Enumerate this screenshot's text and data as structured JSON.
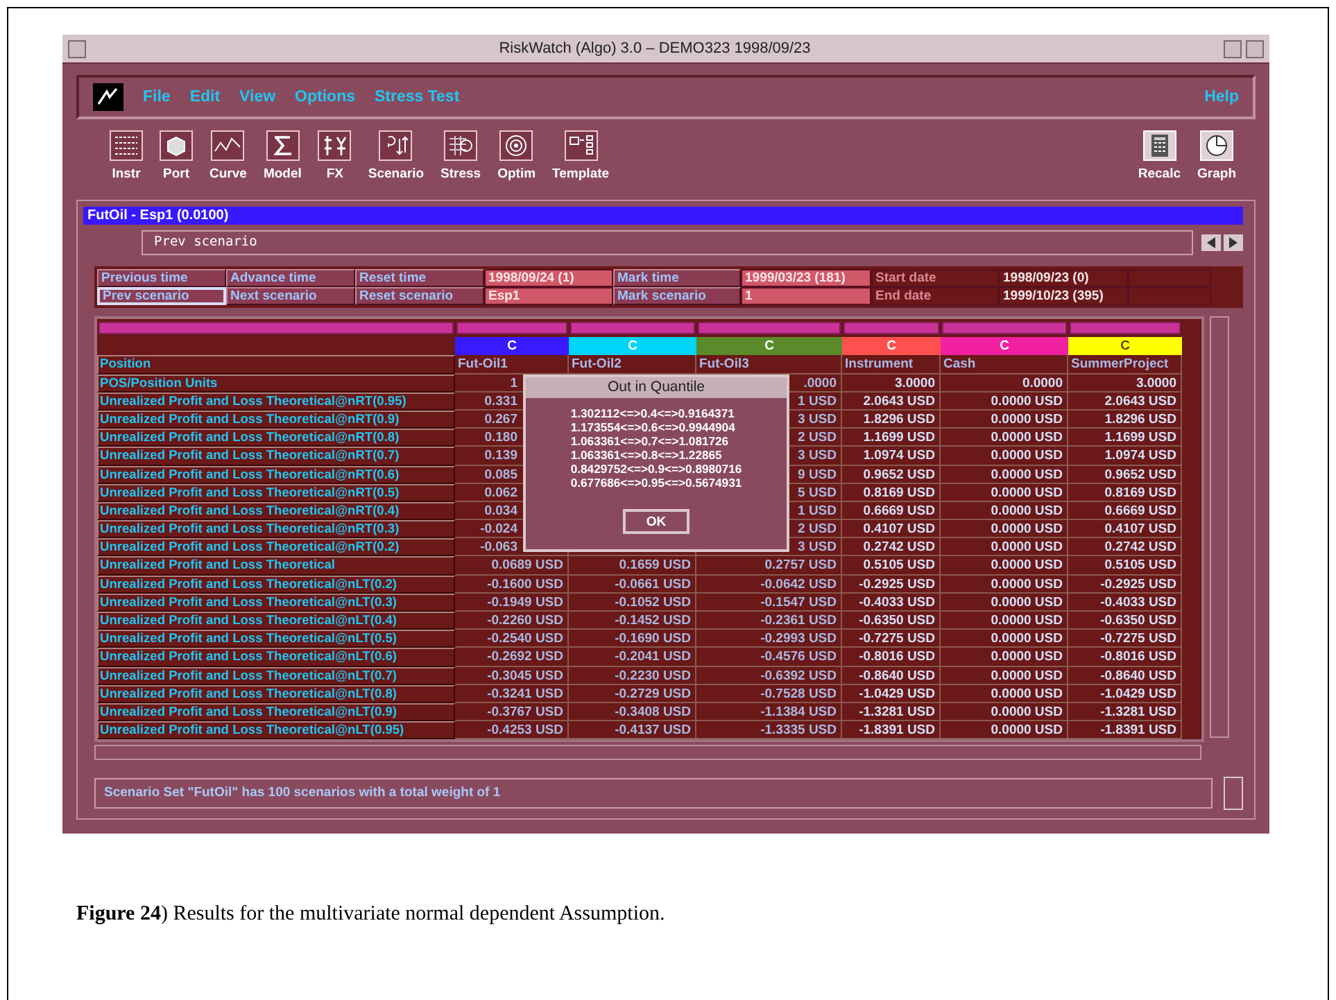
{
  "window": {
    "title": "RiskWatch (Algo) 3.0 – DEMO323 1998/09/23"
  },
  "menu": [
    {
      "label": "File"
    },
    {
      "label": "Edit"
    },
    {
      "label": "View"
    },
    {
      "label": "Options"
    },
    {
      "label": "Stress Test"
    }
  ],
  "help_menu": {
    "label": "Help"
  },
  "toolbar": [
    {
      "label": "Instr",
      "kind": "instr"
    },
    {
      "label": "Port",
      "kind": "port"
    },
    {
      "label": "Curve",
      "kind": "curve"
    },
    {
      "label": "Model",
      "kind": "model"
    },
    {
      "label": "FX",
      "kind": "fx"
    },
    {
      "label": "Scenario",
      "kind": "scenario"
    },
    {
      "label": "Stress",
      "kind": "stress"
    },
    {
      "label": "Optim",
      "kind": "optim"
    },
    {
      "label": "Template",
      "kind": "template"
    }
  ],
  "toolbar_right": [
    {
      "label": "Recalc",
      "kind": "recalc"
    },
    {
      "label": "Graph",
      "kind": "graph"
    }
  ],
  "context_bar": "FutOil - Esp1 (0.0100)",
  "message": "Prev scenario",
  "control_grid": [
    [
      {
        "text": "Previous time",
        "kind": "button",
        "selected": false
      },
      {
        "text": "Advance time",
        "kind": "button",
        "selected": false
      },
      {
        "text": "Reset time",
        "kind": "button",
        "selected": false
      },
      {
        "text": "1998/09/24 (1)",
        "kind": "value"
      },
      {
        "text": "Mark time",
        "kind": "button",
        "selected": false
      },
      {
        "text": "1999/03/23 (181)",
        "kind": "value"
      },
      {
        "text": "Start date",
        "kind": "label"
      },
      {
        "text": "1998/09/23 (0)",
        "kind": "info"
      },
      {
        "kind": "blank"
      }
    ],
    [
      {
        "text": "Prev scenario",
        "kind": "button",
        "selected": true
      },
      {
        "text": "Next scenario",
        "kind": "button",
        "selected": false
      },
      {
        "text": "Reset scenario",
        "kind": "button",
        "selected": false
      },
      {
        "text": "Esp1",
        "kind": "value"
      },
      {
        "text": "Mark scenario",
        "kind": "button",
        "selected": false
      },
      {
        "text": "1",
        "kind": "value"
      },
      {
        "text": "End date",
        "kind": "label"
      },
      {
        "text": "1999/10/23 (395)",
        "kind": "info"
      },
      {
        "kind": "blank"
      }
    ]
  ],
  "table": {
    "label_header": "Position",
    "columns": [
      {
        "letter": "C",
        "color": "#3a1aff",
        "name": "Fut-Oil1"
      },
      {
        "letter": "C",
        "color": "#00d4f8",
        "name": "Fut-Oil2"
      },
      {
        "letter": "C",
        "color": "#5a8a2a",
        "name": "Fut-Oil3"
      },
      {
        "letter": "C",
        "color": "#ff5050",
        "name": "Instrument"
      },
      {
        "letter": "C",
        "color": "#f020a0",
        "name": "Cash"
      },
      {
        "letter": "C",
        "color": "#ffff00",
        "name": "SummerProject"
      }
    ],
    "rows": [
      {
        "label": "POS/Position Units",
        "covered": true,
        "cells": [
          "1",
          null,
          ".0000",
          "3.0000",
          "0.0000",
          "3.0000"
        ]
      },
      {
        "label": "Unrealized Profit and Loss Theoretical@nRT(0.95)",
        "covered": true,
        "cells": [
          "0.331",
          null,
          "1 USD",
          "2.0643 USD",
          "0.0000 USD",
          "2.0643 USD"
        ]
      },
      {
        "label": "Unrealized Profit and Loss Theoretical@nRT(0.9)",
        "covered": true,
        "cells": [
          "0.267",
          null,
          "3 USD",
          "1.8296 USD",
          "0.0000 USD",
          "1.8296 USD"
        ]
      },
      {
        "label": "Unrealized Profit and Loss Theoretical@nRT(0.8)",
        "covered": true,
        "cells": [
          "0.180",
          null,
          "2 USD",
          "1.1699 USD",
          "0.0000 USD",
          "1.1699 USD"
        ]
      },
      {
        "label": "Unrealized Profit and Loss Theoretical@nRT(0.7)",
        "covered": true,
        "cells": [
          "0.139",
          null,
          "3 USD",
          "1.0974 USD",
          "0.0000 USD",
          "1.0974 USD"
        ]
      },
      {
        "label": "Unrealized Profit and Loss Theoretical@nRT(0.6)",
        "covered": true,
        "cells": [
          "0.085",
          null,
          "9 USD",
          "0.9652 USD",
          "0.0000 USD",
          "0.9652 USD"
        ]
      },
      {
        "label": "Unrealized Profit and Loss Theoretical@nRT(0.5)",
        "covered": true,
        "cells": [
          "0.062",
          null,
          "5 USD",
          "0.8169 USD",
          "0.0000 USD",
          "0.8169 USD"
        ]
      },
      {
        "label": "Unrealized Profit and Loss Theoretical@nRT(0.4)",
        "covered": true,
        "cells": [
          "0.034",
          null,
          "1 USD",
          "0.6669 USD",
          "0.0000 USD",
          "0.6669 USD"
        ]
      },
      {
        "label": "Unrealized Profit and Loss Theoretical@nRT(0.3)",
        "covered": true,
        "cells": [
          "-0.024",
          null,
          "2 USD",
          "0.4107 USD",
          "0.0000 USD",
          "0.4107 USD"
        ]
      },
      {
        "label": "Unrealized Profit and Loss Theoretical@nRT(0.2)",
        "covered": true,
        "cells": [
          "-0.063",
          null,
          "3 USD",
          "0.2742 USD",
          "0.0000 USD",
          "0.2742 USD"
        ]
      },
      {
        "label": "Unrealized Profit and Loss Theoretical",
        "covered": false,
        "cells": [
          "0.0689 USD",
          "0.1659 USD",
          "0.2757 USD",
          "0.5105 USD",
          "0.0000 USD",
          "0.5105 USD"
        ]
      },
      {
        "label": "Unrealized Profit and Loss Theoretical@nLT(0.2)",
        "covered": false,
        "cells": [
          "-0.1600 USD",
          "-0.0661 USD",
          "-0.0642 USD",
          "-0.2925 USD",
          "0.0000 USD",
          "-0.2925 USD"
        ]
      },
      {
        "label": "Unrealized Profit and Loss Theoretical@nLT(0.3)",
        "covered": false,
        "cells": [
          "-0.1949 USD",
          "-0.1052 USD",
          "-0.1547 USD",
          "-0.4033 USD",
          "0.0000 USD",
          "-0.4033 USD"
        ]
      },
      {
        "label": "Unrealized Profit and Loss Theoretical@nLT(0.4)",
        "covered": false,
        "cells": [
          "-0.2260 USD",
          "-0.1452 USD",
          "-0.2361 USD",
          "-0.6350 USD",
          "0.0000 USD",
          "-0.6350 USD"
        ]
      },
      {
        "label": "Unrealized Profit and Loss Theoretical@nLT(0.5)",
        "covered": false,
        "cells": [
          "-0.2540 USD",
          "-0.1690 USD",
          "-0.2993 USD",
          "-0.7275 USD",
          "0.0000 USD",
          "-0.7275 USD"
        ]
      },
      {
        "label": "Unrealized Profit and Loss Theoretical@nLT(0.6)",
        "covered": false,
        "cells": [
          "-0.2692 USD",
          "-0.2041 USD",
          "-0.4576 USD",
          "-0.8016 USD",
          "0.0000 USD",
          "-0.8016 USD"
        ]
      },
      {
        "label": "Unrealized Profit and Loss Theoretical@nLT(0.7)",
        "covered": false,
        "cells": [
          "-0.3045 USD",
          "-0.2230 USD",
          "-0.6392 USD",
          "-0.8640 USD",
          "0.0000 USD",
          "-0.8640 USD"
        ]
      },
      {
        "label": "Unrealized Profit and Loss Theoretical@nLT(0.8)",
        "covered": false,
        "cells": [
          "-0.3241 USD",
          "-0.2729 USD",
          "-0.7528 USD",
          "-1.0429 USD",
          "0.0000 USD",
          "-1.0429 USD"
        ]
      },
      {
        "label": "Unrealized Profit and Loss Theoretical@nLT(0.9)",
        "covered": false,
        "cells": [
          "-0.3767 USD",
          "-0.3408 USD",
          "-1.1384 USD",
          "-1.3281 USD",
          "0.0000 USD",
          "-1.3281 USD"
        ]
      },
      {
        "label": "Unrealized Profit and Loss Theoretical@nLT(0.95)",
        "covered": false,
        "cells": [
          "-0.4253 USD",
          "-0.4137 USD",
          "-1.3335 USD",
          "-1.8391 USD",
          "0.0000 USD",
          "-1.8391 USD"
        ]
      }
    ]
  },
  "dialog": {
    "title": "Out in Quantile",
    "lines": [
      "1.302112<=>0.4<=>0.9164371",
      "1.173554<=>0.6<=>0.9944904",
      "1.063361<=>0.7<=>1.081726",
      "1.063361<=>0.8<=>1.22865",
      "0.8429752<=>0.9<=>0.8980716",
      "0.677686<=>0.95<=>0.5674931"
    ],
    "button": "OK"
  },
  "status": "Scenario Set \"FutOil\" has 100 scenarios with a total weight of 1",
  "caption": "**Figure 24**) Results for the multivariate normal dependent Assumption."
}
